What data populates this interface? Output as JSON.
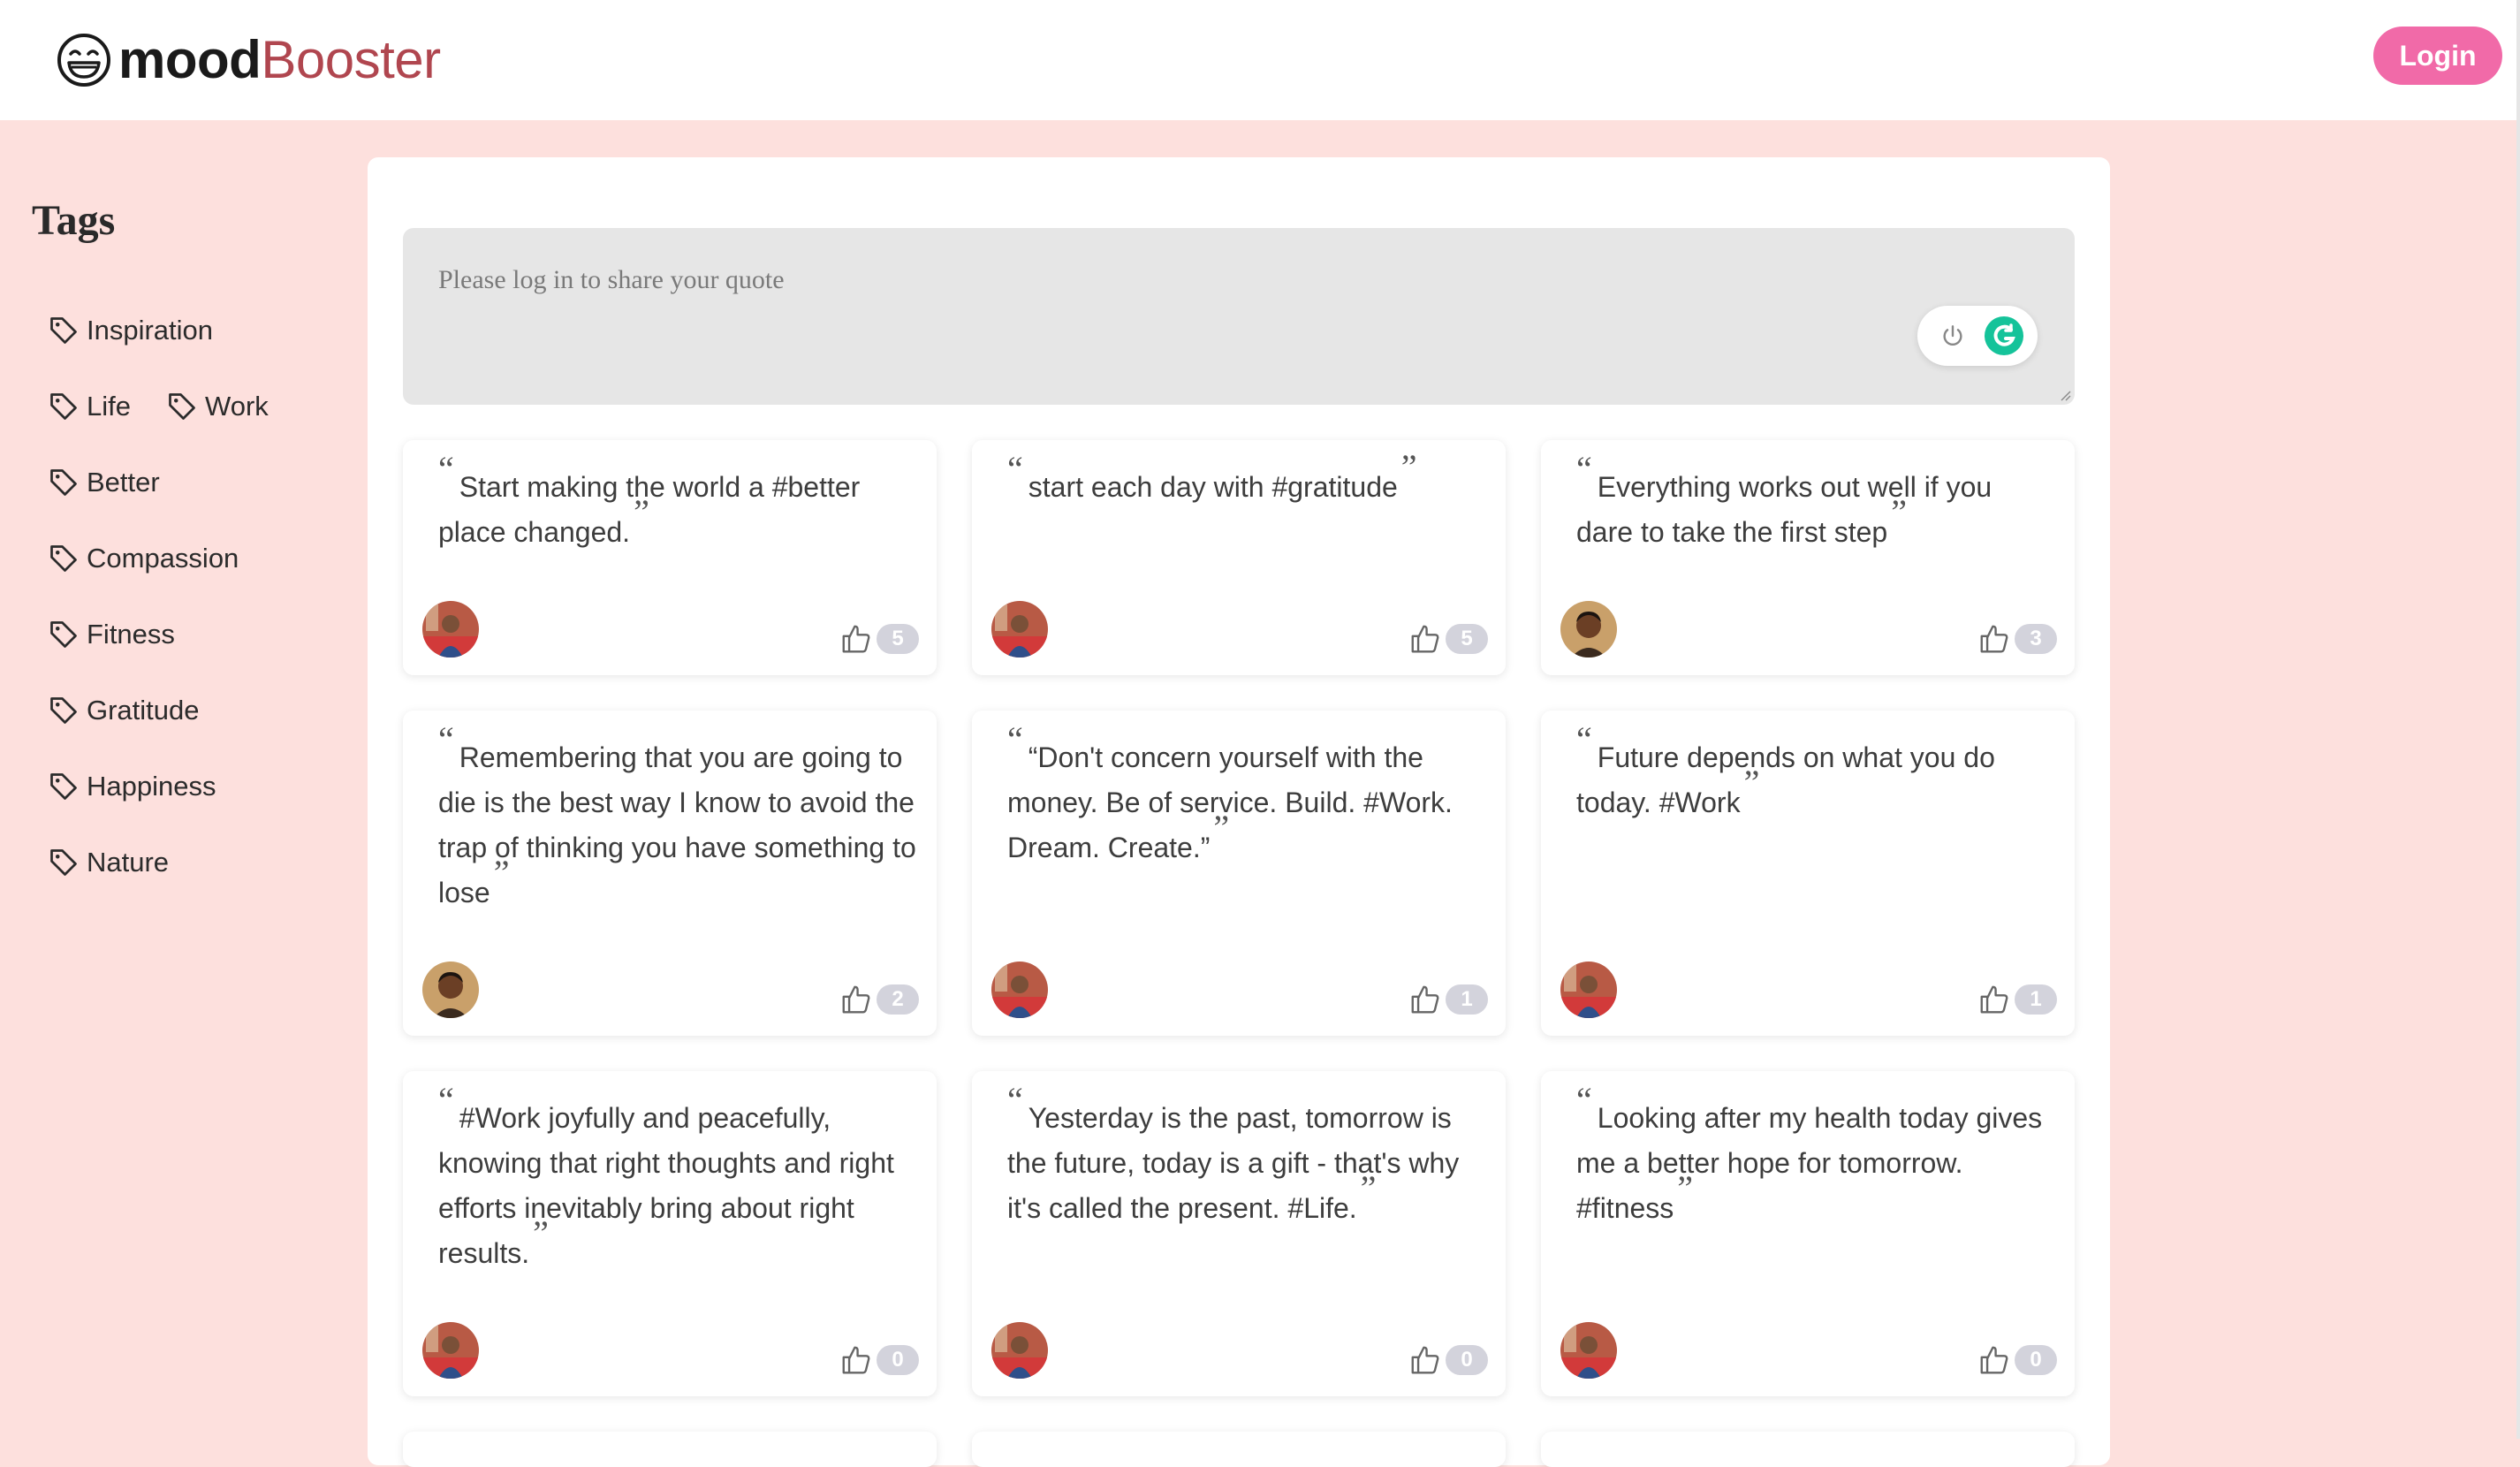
{
  "header": {
    "logo_part1": "mood",
    "logo_part2": "Booster",
    "login_label": "Login"
  },
  "colors": {
    "page_bg": "#fde0dd",
    "brand_red": "#b0464f",
    "login_pink": "#f16aa8",
    "badge_gray": "#d3d3dc"
  },
  "sidebar": {
    "title": "Tags",
    "tags": [
      {
        "label": "Inspiration",
        "icon": "tag-icon"
      },
      {
        "label": "Life",
        "icon": "tag-icon"
      },
      {
        "label": "Work",
        "icon": "tag-icon"
      },
      {
        "label": "Better",
        "icon": "tag-icon"
      },
      {
        "label": "Compassion",
        "icon": "tag-icon"
      },
      {
        "label": "Fitness",
        "icon": "tag-icon"
      },
      {
        "label": "Gratitude",
        "icon": "tag-icon"
      },
      {
        "label": "Happiness",
        "icon": "tag-icon"
      },
      {
        "label": "Nature",
        "icon": "tag-icon"
      }
    ]
  },
  "composer": {
    "placeholder": "Please log in to share your quote"
  },
  "quotes": [
    {
      "text": "Start making the world a #better place changed.",
      "likes": "5",
      "avatar": "red-avatar"
    },
    {
      "text": "start each day with #gratitude",
      "likes": "5",
      "avatar": "red-avatar"
    },
    {
      "text": "Everything works out well if you dare to take the first step",
      "likes": "3",
      "avatar": "portrait-avatar"
    },
    {
      "text": "Remembering that you are going to die is the best way I know to avoid the trap of thinking you have something to lose",
      "likes": "2",
      "avatar": "portrait-avatar"
    },
    {
      "text": "“Don't concern yourself with the money. Be of service. Build. #Work. Dream. Create.”",
      "likes": "1",
      "avatar": "red-avatar"
    },
    {
      "text": "Future depends on what you do today. #Work",
      "likes": "1",
      "avatar": "red-avatar"
    },
    {
      "text": "#Work joyfully and peacefully, knowing that right thoughts and right efforts inevitably bring about right results.",
      "likes": "0",
      "avatar": "red-avatar"
    },
    {
      "text": "Yesterday is the past, tomorrow is the future, today is a gift - that's why it's called the present. #Life.",
      "likes": "0",
      "avatar": "red-avatar"
    },
    {
      "text": "Looking after my health today gives me a better hope for tomorrow. #fitness",
      "likes": "0",
      "avatar": "red-avatar"
    }
  ]
}
